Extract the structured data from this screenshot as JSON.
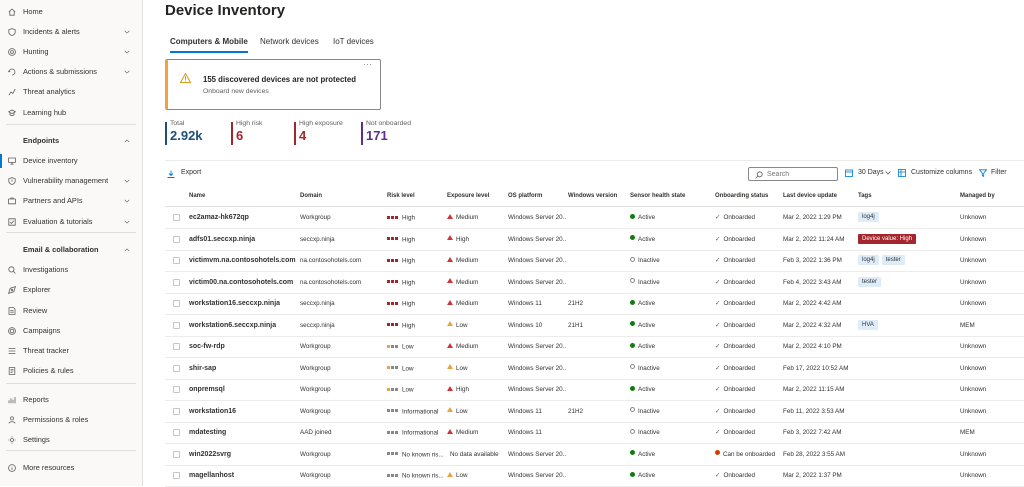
{
  "sidebar": {
    "items": [
      {
        "label": "Home",
        "icon": "home-icon",
        "chevron": false
      },
      {
        "label": "Incidents & alerts",
        "icon": "shield-icon",
        "chevron": true
      },
      {
        "label": "Hunting",
        "icon": "hunting-icon",
        "chevron": true
      },
      {
        "label": "Actions & submissions",
        "icon": "actions-icon",
        "chevron": true
      },
      {
        "label": "Threat analytics",
        "icon": "threat-analytics-icon",
        "chevron": false
      },
      {
        "label": "Learning hub",
        "icon": "learning-hub-icon",
        "chevron": false
      },
      {
        "label": "Endpoints",
        "icon": "",
        "chevron": true,
        "section": true
      },
      {
        "label": "Device inventory",
        "icon": "device-inventory-icon",
        "chevron": false,
        "active": true
      },
      {
        "label": "Vulnerability management",
        "icon": "vulnerability-icon",
        "chevron": true
      },
      {
        "label": "Partners and APIs",
        "icon": "partners-icon",
        "chevron": true
      },
      {
        "label": "Evaluation & tutorials",
        "icon": "evaluation-icon",
        "chevron": true
      },
      {
        "label": "Email & collaboration",
        "icon": "",
        "chevron": true,
        "section": true
      },
      {
        "label": "Investigations",
        "icon": "investigations-icon",
        "chevron": false
      },
      {
        "label": "Explorer",
        "icon": "explorer-icon",
        "chevron": false
      },
      {
        "label": "Review",
        "icon": "review-icon",
        "chevron": false
      },
      {
        "label": "Campaigns",
        "icon": "campaigns-icon",
        "chevron": false
      },
      {
        "label": "Threat tracker",
        "icon": "threat-tracker-icon",
        "chevron": false
      },
      {
        "label": "Policies & rules",
        "icon": "policies-icon",
        "chevron": false
      },
      {
        "label": "Reports",
        "icon": "reports-icon",
        "chevron": false
      },
      {
        "label": "Permissions & roles",
        "icon": "permissions-icon",
        "chevron": false
      },
      {
        "label": "Settings",
        "icon": "settings-icon",
        "chevron": false
      },
      {
        "label": "More resources",
        "icon": "info-icon",
        "chevron": false
      }
    ]
  },
  "page": {
    "title": "Device Inventory",
    "tabs": [
      "Computers & Mobile",
      "Network devices",
      "IoT devices"
    ]
  },
  "banner": {
    "title": "155 discovered devices are not protected",
    "subtitle": "Onboard new devices",
    "more": "···"
  },
  "stats": [
    {
      "label": "Total",
      "value": "2.92k",
      "color": "#1f4e79"
    },
    {
      "label": "High risk",
      "value": "6",
      "color": "#a4262c"
    },
    {
      "label": "High exposure",
      "value": "4",
      "color": "#a4262c"
    },
    {
      "label": "Not onboarded",
      "value": "171",
      "color": "#5c2e91"
    }
  ],
  "toolbar": {
    "export_label": "Export",
    "search_placeholder": "Search",
    "days_label": "30 Days",
    "customize_label": "Customize columns",
    "filter_label": "Filter"
  },
  "table": {
    "columns": [
      "Name",
      "Domain",
      "Risk level",
      "Exposure level",
      "OS platform",
      "Windows version",
      "Sensor health state",
      "Onboarding status",
      "Last device update",
      "Tags",
      "Managed by"
    ],
    "rows": [
      {
        "name": "ec2amaz-hk672qp",
        "domain": "Workgroup",
        "risk": "High",
        "exposure": "Medium",
        "os": "Windows Server 20...",
        "ver": "",
        "sensor": "Active",
        "onboard": "Onboarded",
        "update": "Mar 2, 2022 1:29 PM",
        "tags": [
          {
            "t": "log4j",
            "c": "plain"
          }
        ],
        "managed": "Unknown"
      },
      {
        "name": "adfs01.seccxp.ninja",
        "domain": "seccxp.ninja",
        "risk": "High",
        "exposure": "High",
        "os": "Windows Server 20...",
        "ver": "",
        "sensor": "Active",
        "onboard": "Onboarded",
        "update": "Mar 2, 2022 11:24 AM",
        "tags": [
          {
            "t": "Device value: High",
            "c": "red"
          }
        ],
        "managed": "Unknown"
      },
      {
        "name": "victimvm.na.contosohotels.com",
        "domain": "na.contosohotels.com",
        "risk": "High",
        "exposure": "Medium",
        "os": "Windows Server 20...",
        "ver": "",
        "sensor": "Inactive",
        "onboard": "Onboarded",
        "update": "Feb 3, 2022 1:36 PM",
        "tags": [
          {
            "t": "log4j",
            "c": "plain"
          },
          {
            "t": "tester",
            "c": "plain"
          }
        ],
        "managed": "Unknown"
      },
      {
        "name": "victim00.na.contosohotels.com",
        "domain": "na.contosohotels.com",
        "risk": "High",
        "exposure": "Medium",
        "os": "Windows Server 20...",
        "ver": "",
        "sensor": "Inactive",
        "onboard": "Onboarded",
        "update": "Feb 4, 2022 3:43 AM",
        "tags": [
          {
            "t": "tester",
            "c": "plain"
          }
        ],
        "managed": "Unknown"
      },
      {
        "name": "workstation16.seccxp.ninja",
        "domain": "seccxp.ninja",
        "risk": "High",
        "exposure": "Medium",
        "os": "Windows 11",
        "ver": "21H2",
        "sensor": "Active",
        "onboard": "Onboarded",
        "update": "Mar 2, 2022 4:42 AM",
        "tags": [],
        "managed": "Unknown"
      },
      {
        "name": "workstation6.seccxp.ninja",
        "domain": "seccxp.ninja",
        "risk": "High",
        "exposure": "Low",
        "os": "Windows 10",
        "ver": "21H1",
        "sensor": "Active",
        "onboard": "Onboarded",
        "update": "Mar 2, 2022 4:32 AM",
        "tags": [
          {
            "t": "HVA",
            "c": "plain"
          }
        ],
        "managed": "MEM"
      },
      {
        "name": "soc-fw-rdp",
        "domain": "Workgroup",
        "risk": "Low",
        "exposure": "Medium",
        "os": "Windows Server 20...",
        "ver": "",
        "sensor": "Active",
        "onboard": "Onboarded",
        "update": "Mar 2, 2022 4:10 PM",
        "tags": [],
        "managed": "Unknown"
      },
      {
        "name": "shir-sap",
        "domain": "Workgroup",
        "risk": "Low",
        "exposure": "Low",
        "os": "Windows Server 20...",
        "ver": "",
        "sensor": "Inactive",
        "onboard": "Onboarded",
        "update": "Feb 17, 2022 10:52 AM",
        "tags": [],
        "managed": "Unknown"
      },
      {
        "name": "onpremsql",
        "domain": "Workgroup",
        "risk": "Low",
        "exposure": "High",
        "os": "Windows Server 20...",
        "ver": "",
        "sensor": "Active",
        "onboard": "Onboarded",
        "update": "Mar 2, 2022 11:15 AM",
        "tags": [],
        "managed": "Unknown"
      },
      {
        "name": "workstation16",
        "domain": "Workgroup",
        "risk": "Informational",
        "exposure": "Low",
        "os": "Windows 11",
        "ver": "21H2",
        "sensor": "Inactive",
        "onboard": "Onboarded",
        "update": "Feb 11, 2022 3:53 AM",
        "tags": [],
        "managed": "Unknown"
      },
      {
        "name": "mdatesting",
        "domain": "AAD joined",
        "risk": "Informational",
        "exposure": "Medium",
        "os": "Windows 11",
        "ver": "",
        "sensor": "Inactive",
        "onboard": "Onboarded",
        "update": "Feb 3, 2022 7:42 AM",
        "tags": [],
        "managed": "MEM"
      },
      {
        "name": "win2022svrg",
        "domain": "Workgroup",
        "risk": "No known ris...",
        "exposure": "No data available",
        "os": "Windows Server 20...",
        "ver": "",
        "sensor": "Active",
        "onboard": "Can be onboarded",
        "update": "Feb 28, 2022 3:55 AM",
        "tags": [],
        "managed": "Unknown"
      },
      {
        "name": "magellanhost",
        "domain": "Workgroup",
        "risk": "No known ris...",
        "exposure": "Low",
        "os": "Windows Server 20...",
        "ver": "",
        "sensor": "Active",
        "onboard": "Onboarded",
        "update": "Mar 2, 2022 1:37 PM",
        "tags": [],
        "managed": "Unknown"
      }
    ]
  },
  "colors": {
    "accent": "#0078d4",
    "risk_high": "#a4262c",
    "risk_low": "#e8a33d",
    "risk_info": "#8a8886",
    "exposure_high": "#d13438",
    "exposure_medium": "#d13438",
    "exposure_low": "#e8a33d",
    "active": "#107c10",
    "warning": "#d83b01"
  }
}
